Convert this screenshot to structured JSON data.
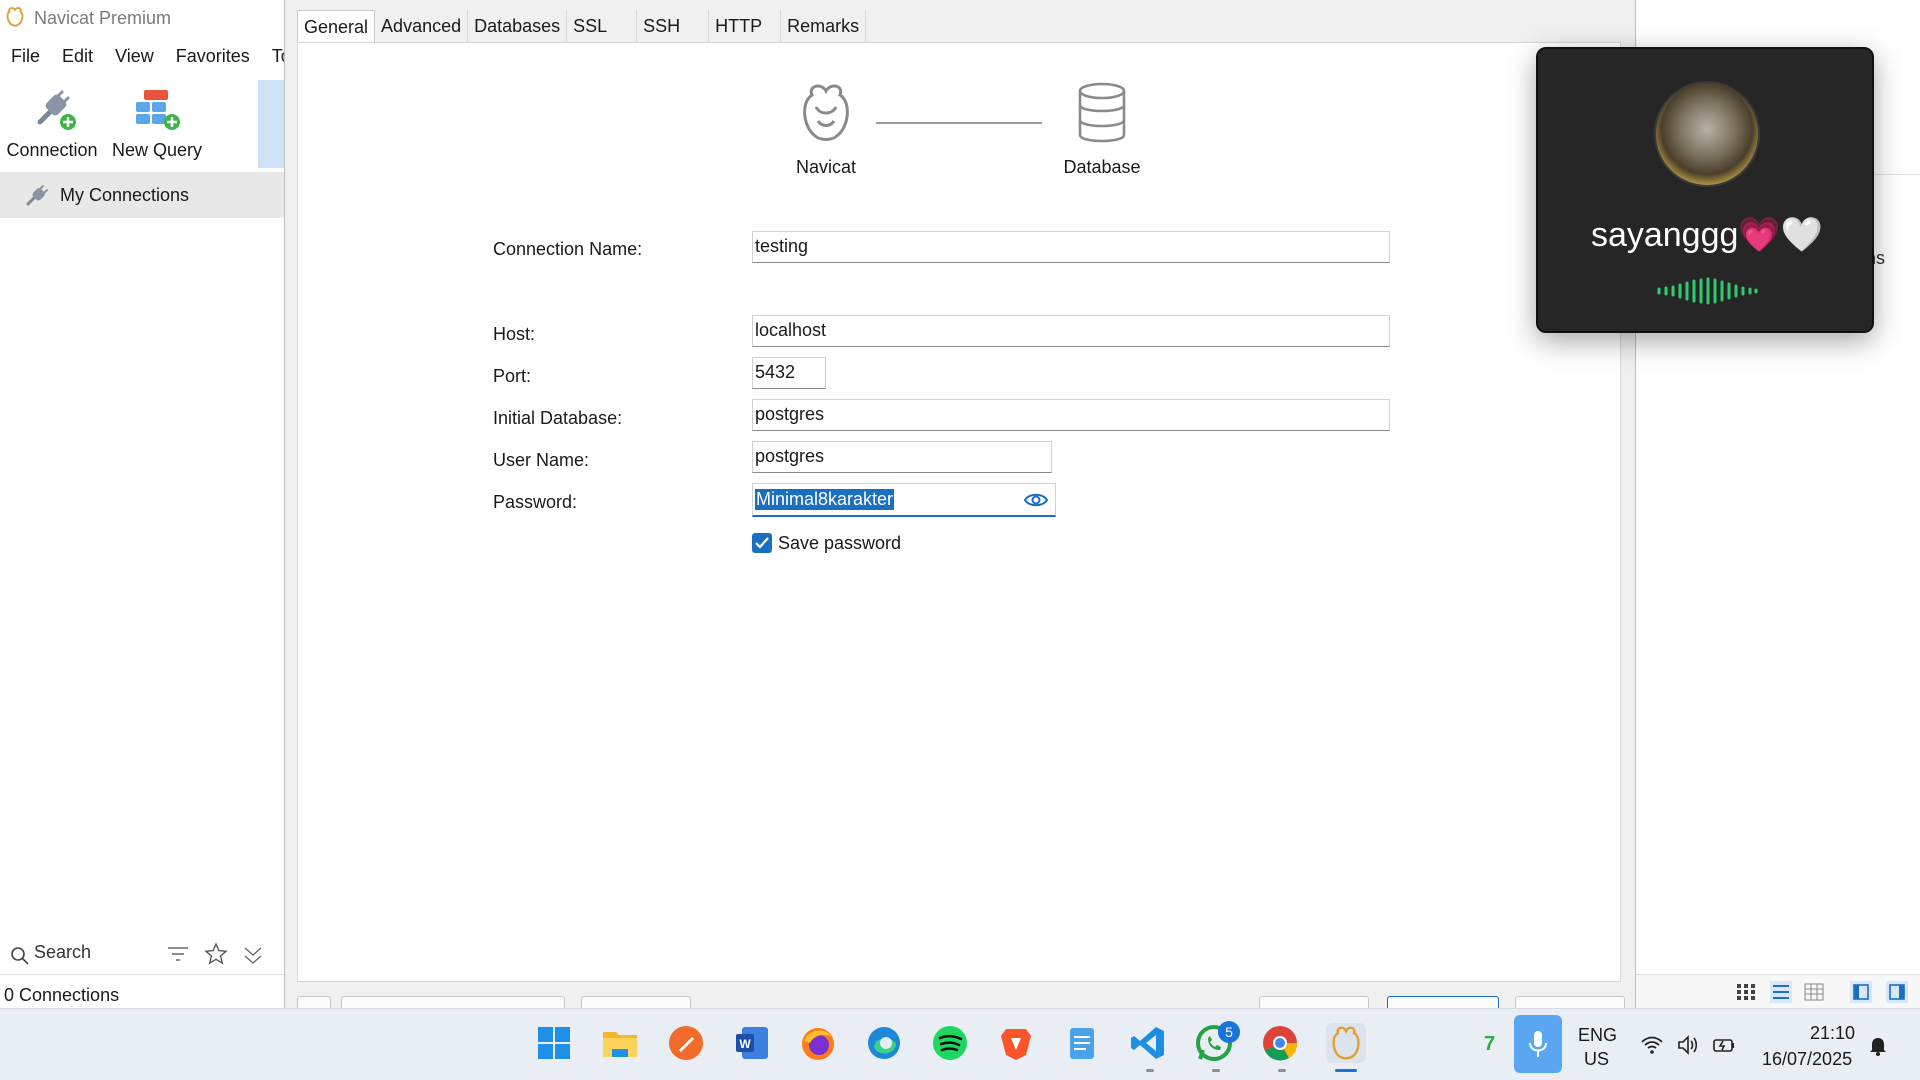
{
  "app": {
    "title": "Navicat Premium"
  },
  "menu": {
    "items": [
      "File",
      "Edit",
      "View",
      "Favorites",
      "To"
    ]
  },
  "toolbar": {
    "connection_label": "Connection",
    "new_query_label": "New Query"
  },
  "sidebar": {
    "item_label": "My Connections",
    "search_label": "Search",
    "status": "0 Connections"
  },
  "right_panel": {
    "partial_text": "ns"
  },
  "dialog": {
    "tabs": [
      "General",
      "Advanced",
      "Databases",
      "SSL",
      "SSH",
      "HTTP",
      "Remarks"
    ],
    "active_tab": "General",
    "graphic": {
      "left_caption": "Navicat",
      "right_caption": "Database"
    },
    "form": {
      "connection_name_label": "Connection Name:",
      "connection_name_value": "testing",
      "host_label": "Host:",
      "host_value": "localhost",
      "port_label": "Port:",
      "port_value": "5432",
      "initial_db_label": "Initial Database:",
      "initial_db_value": "postgres",
      "username_label": "User Name:",
      "username_value": "postgres",
      "password_label": "Password:",
      "password_value": "Minimal8karakter",
      "save_password_label": "Save password",
      "save_password_checked": true
    }
  },
  "call": {
    "caller_name": "sayanggg💗🤍"
  },
  "taskbar": {
    "whatsapp_badge": "5",
    "weather_value": "7",
    "lang_top": "ENG",
    "lang_bottom": "US",
    "time": "21:10",
    "date": "16/07/2025"
  },
  "colors": {
    "accent": "#1a6fc0",
    "taskbar_bg": "#e9edf4",
    "overlay_bg": "#262626",
    "voice_wave": "#2ecc71"
  }
}
